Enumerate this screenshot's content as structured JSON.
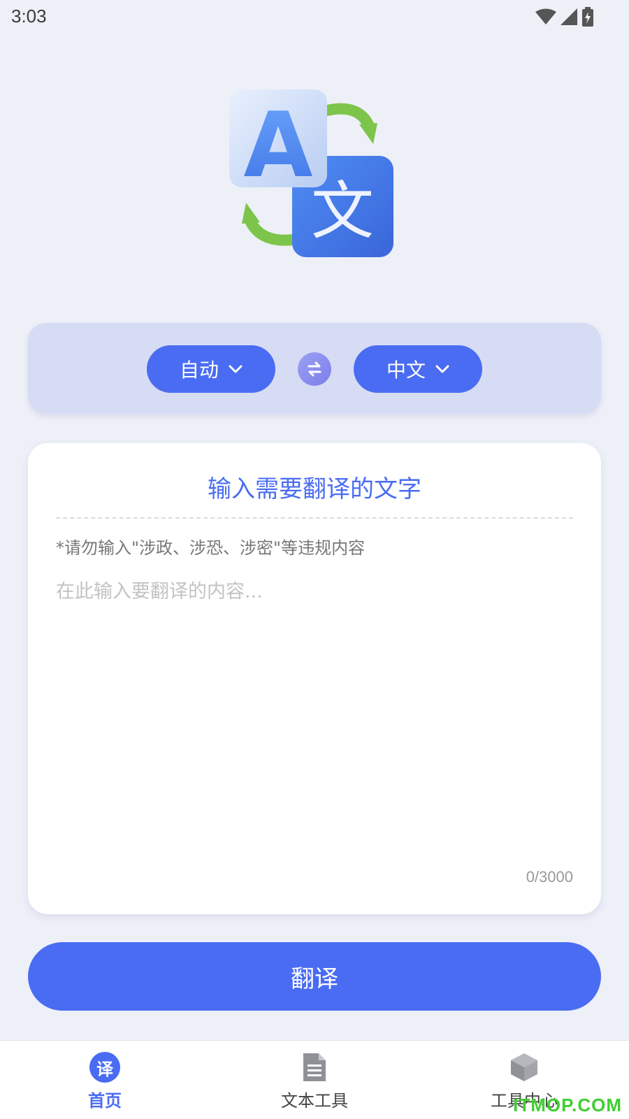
{
  "status_bar": {
    "time": "3:03",
    "icons": [
      "wifi-icon",
      "signal-icon",
      "battery-charging-icon"
    ]
  },
  "logo": {
    "letter_a": "A",
    "letter_wen": "文"
  },
  "language_selector": {
    "source_language": "自动",
    "target_language": "中文"
  },
  "input_card": {
    "title": "输入需要翻译的文字",
    "warning": "*请勿输入\"涉政、涉恐、涉密\"等违规内容",
    "placeholder": "在此输入要翻译的内容...",
    "value": "",
    "counter": "0/3000"
  },
  "translate_button": {
    "label": "翻译"
  },
  "bottom_nav": {
    "items": [
      {
        "label": "首页",
        "icon": "translate-badge-icon",
        "badge_text": "译",
        "active": true
      },
      {
        "label": "文本工具",
        "icon": "document-icon",
        "active": false
      },
      {
        "label": "工具中心",
        "icon": "cube-icon",
        "active": false
      }
    ]
  },
  "watermark": "ITMOP.COM",
  "colors": {
    "accent": "#4a6cf2",
    "background": "#eef0f8",
    "panel": "#d7dcf5",
    "watermark": "#3ecf2f"
  }
}
